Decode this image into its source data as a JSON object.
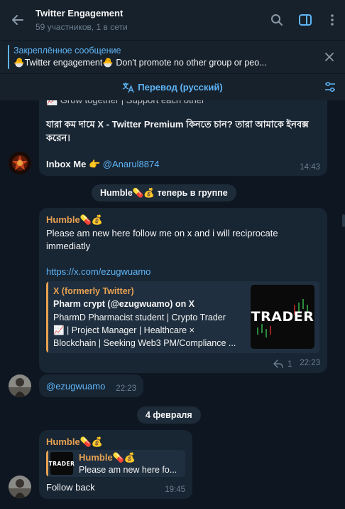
{
  "header": {
    "title": "Twitter Engagement",
    "subtitle": "59 участников, 1 в сети"
  },
  "pinned": {
    "title": "Закреплённое сообщение",
    "body": "🐣Twitter engagement🐣 Don't promote no other group or peo..."
  },
  "translate": {
    "label": "Перевод (русский)"
  },
  "messages": {
    "m1": {
      "cut_line": "📈 Grow together | Support each other",
      "bengali": "যারা কম দামে X - Twitter Premium কিনতে চান? তারা আমাকে ইনবক্স করেন।",
      "inbox_text": "Inbox Me 👉",
      "inbox_handle": "@Anarul8874",
      "time": "14:43"
    },
    "service_join": "Humble💊💰 теперь в группе",
    "m2": {
      "name": "Humble💊💰",
      "text1": "Please am new here follow me on x and i will reciprocate",
      "text2": "immediatly",
      "link": "https://x.com/ezugwuamo",
      "preview": {
        "site": "X (formerly Twitter)",
        "title": "Pharm crypt (@ezugwuamo) on X",
        "desc1": "PharmD Pharmacist student | Crypto Trader",
        "desc2": "📈 | Project Manager | Healthcare ×",
        "desc3": "Blockchain | Seeking Web3 PM/Compliance ...",
        "image_text": "TRADER"
      },
      "replies": "1",
      "time": "22:23"
    },
    "m3": {
      "text": "@ezugwuamo",
      "time": "22:23"
    },
    "date_sep": "4 февраля",
    "m4": {
      "name": "Humble💊💰",
      "reply_name": "Humble💊💰",
      "reply_text": "Please am new here fo...",
      "reply_image_text": "TRADER",
      "text": "Follow back",
      "time": "19:45"
    }
  },
  "colors": {
    "background": "#0e1621",
    "panel": "#17212b",
    "bubble": "#182533",
    "accent": "#5eb5f7",
    "name": "#e7a151"
  }
}
